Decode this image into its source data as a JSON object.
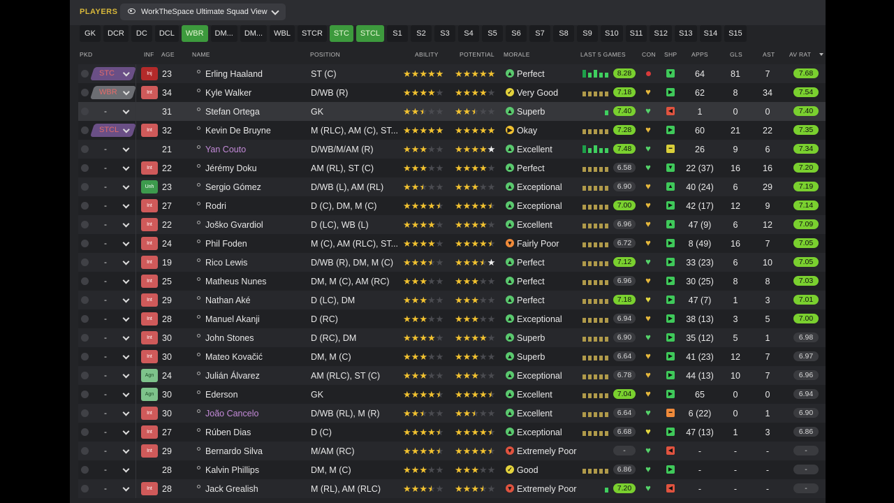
{
  "header": {
    "players_label": "PLAYERS",
    "view_name": "WorkTheSpace Ultimate Squad View"
  },
  "position_filters": [
    {
      "label": "GK",
      "active": false
    },
    {
      "label": "DCR",
      "active": false
    },
    {
      "label": "DC",
      "active": false
    },
    {
      "label": "DCL",
      "active": false
    },
    {
      "label": "WBR",
      "active": true
    },
    {
      "label": "DM...",
      "active": false
    },
    {
      "label": "DM...",
      "active": false
    },
    {
      "label": "WBL",
      "active": false
    },
    {
      "label": "STCR",
      "active": false
    },
    {
      "label": "STC",
      "active": true
    },
    {
      "label": "STCL",
      "active": true
    },
    {
      "label": "S1",
      "active": false
    },
    {
      "label": "S2",
      "active": false
    },
    {
      "label": "S3",
      "active": false
    },
    {
      "label": "S4",
      "active": false
    },
    {
      "label": "S5",
      "active": false
    },
    {
      "label": "S6",
      "active": false
    },
    {
      "label": "S7",
      "active": false
    },
    {
      "label": "S8",
      "active": false
    },
    {
      "label": "S9",
      "active": false
    },
    {
      "label": "S10",
      "active": false
    },
    {
      "label": "S11",
      "active": false
    },
    {
      "label": "S12",
      "active": false
    },
    {
      "label": "S13",
      "active": false
    },
    {
      "label": "S14",
      "active": false
    },
    {
      "label": "S15",
      "active": false
    }
  ],
  "columns": {
    "pkd": "PKD",
    "inf": "INF",
    "age": "AGE",
    "name": "NAME",
    "position": "POSITION",
    "ability": "ABILITY",
    "potential": "POTENTIAL",
    "morale": "MORALE",
    "last5": "LAST 5 GAMES",
    "con": "CON",
    "shp": "SHP",
    "apps": "APPS",
    "gls": "GLS",
    "ast": "AST",
    "avrat": "AV RAT"
  },
  "colors": {
    "accent": "#d8b83a",
    "active_green": "#3d9a3d",
    "rating_green": "#7ad02f",
    "star": "#f2c230"
  },
  "players": [
    {
      "pkd": "STC",
      "inf": "Inj",
      "age": "23",
      "name": "Erling Haaland",
      "purple": false,
      "position": "ST (C)",
      "ability": 5,
      "potential": 5,
      "pot_white": 0,
      "morale": "Perfect",
      "morale_icon": "up-arrow",
      "form": "bars5g",
      "rating": "8.28",
      "rating_green": true,
      "con": "red-dot",
      "shp": "down",
      "apps": "64",
      "gls": "81",
      "ast": "7",
      "avrat": "7.68",
      "avrat_green": true
    },
    {
      "pkd": "WBR",
      "inf": "Int",
      "age": "34",
      "name": "Kyle Walker",
      "purple": false,
      "position": "D/WB (R)",
      "ability": 4,
      "potential": 4,
      "pot_white": 0,
      "morale": "Very Good",
      "morale_icon": "check",
      "form": "bars",
      "rating": "7.18",
      "rating_green": true,
      "con": "heart-gold",
      "shp": "green",
      "apps": "62",
      "gls": "8",
      "ast": "34",
      "avrat": "7.54",
      "avrat_green": true
    },
    {
      "pkd": "-",
      "inf": "",
      "age": "31",
      "name": "Stefan Ortega",
      "purple": false,
      "position": "GK",
      "ability": 2.5,
      "potential": 2.5,
      "pot_white": 0,
      "morale": "Superb",
      "morale_icon": "up-arrow",
      "form": "single",
      "rating": "7.40",
      "rating_green": true,
      "con": "heart-green",
      "shp": "red",
      "apps": "1",
      "gls": "0",
      "ast": "0",
      "avrat": "7.40",
      "avrat_green": true
    },
    {
      "pkd": "STCL",
      "inf": "Int",
      "age": "32",
      "name": "Kevin De Bruyne",
      "purple": false,
      "position": "M (RLC), AM (C), ST...",
      "ability": 5,
      "potential": 5,
      "pot_white": 0,
      "morale": "Okay",
      "morale_icon": "right-arrow",
      "form": "bars",
      "rating": "7.28",
      "rating_green": true,
      "con": "heart-gold",
      "shp": "green",
      "apps": "60",
      "gls": "21",
      "ast": "22",
      "avrat": "7.35",
      "avrat_green": true
    },
    {
      "pkd": "-",
      "inf": "",
      "age": "21",
      "name": "Yan Couto",
      "purple": true,
      "position": "D/WB/M/AM (R)",
      "ability": 3,
      "potential": 4,
      "pot_white": 1,
      "morale": "Excellent",
      "morale_icon": "up-arrow",
      "form": "bars5g",
      "rating": "7.48",
      "rating_green": true,
      "con": "heart-green",
      "shp": "yellow",
      "apps": "26",
      "gls": "9",
      "ast": "6",
      "avrat": "7.34",
      "avrat_green": true
    },
    {
      "pkd": "-",
      "inf": "Int",
      "age": "22",
      "name": "Jérémy Doku",
      "purple": false,
      "position": "AM (RL), ST (C)",
      "ability": 3,
      "potential": 4,
      "pot_white": 0,
      "morale": "Perfect",
      "morale_icon": "up-arrow",
      "form": "bars",
      "rating": "6.58",
      "rating_green": false,
      "con": "heart-green",
      "shp": "down",
      "apps": "22 (37)",
      "gls": "16",
      "ast": "16",
      "avrat": "7.20",
      "avrat_green": true
    },
    {
      "pkd": "-",
      "inf": "Unh",
      "age": "23",
      "name": "Sergio Gómez",
      "purple": false,
      "position": "D/WB (L), AM (RL)",
      "ability": 2.5,
      "potential": 3,
      "pot_white": 0,
      "morale": "Exceptional",
      "morale_icon": "up-arrow",
      "form": "bars",
      "rating": "6.90",
      "rating_green": false,
      "con": "heart-gold",
      "shp": "up",
      "apps": "40 (24)",
      "gls": "6",
      "ast": "29",
      "avrat": "7.19",
      "avrat_green": true
    },
    {
      "pkd": "-",
      "inf": "Int",
      "age": "27",
      "name": "Rodri",
      "purple": false,
      "position": "D (C), DM, M (C)",
      "ability": 4.5,
      "potential": 4.5,
      "pot_white": 0,
      "morale": "Exceptional",
      "morale_icon": "up-arrow",
      "form": "bars",
      "rating": "7.00",
      "rating_green": true,
      "con": "heart-gold",
      "shp": "green",
      "apps": "42 (17)",
      "gls": "12",
      "ast": "9",
      "avrat": "7.14",
      "avrat_green": true
    },
    {
      "pkd": "-",
      "inf": "Int",
      "age": "22",
      "name": "Joško Gvardiol",
      "purple": false,
      "position": "D (LC), WB (L)",
      "ability": 4,
      "potential": 4,
      "pot_white": 0,
      "morale": "Excellent",
      "morale_icon": "up-arrow",
      "form": "bars",
      "rating": "6.96",
      "rating_green": false,
      "con": "heart-gold",
      "shp": "up",
      "apps": "47 (9)",
      "gls": "6",
      "ast": "12",
      "avrat": "7.09",
      "avrat_green": true
    },
    {
      "pkd": "-",
      "inf": "Int",
      "age": "24",
      "name": "Phil Foden",
      "purple": false,
      "position": "M (C), AM (RLC), ST...",
      "ability": 4,
      "potential": 4.5,
      "pot_white": 0,
      "morale": "Fairly Poor",
      "morale_icon": "down-orange",
      "form": "bars",
      "rating": "6.72",
      "rating_green": false,
      "con": "heart-gold",
      "shp": "green",
      "apps": "8 (49)",
      "gls": "16",
      "ast": "7",
      "avrat": "7.05",
      "avrat_green": true
    },
    {
      "pkd": "-",
      "inf": "Int",
      "age": "19",
      "name": "Rico Lewis",
      "purple": false,
      "position": "D/WB (R), DM, M (C)",
      "ability": 3.5,
      "potential": 3.5,
      "pot_white": 1.5,
      "morale": "Perfect",
      "morale_icon": "up-arrow",
      "form": "bars",
      "rating": "7.12",
      "rating_green": true,
      "con": "heart-green",
      "shp": "green",
      "apps": "33 (23)",
      "gls": "6",
      "ast": "10",
      "avrat": "7.05",
      "avrat_green": true
    },
    {
      "pkd": "-",
      "inf": "Int",
      "age": "25",
      "name": "Matheus Nunes",
      "purple": false,
      "position": "DM, M (C), AM (RC)",
      "ability": 3,
      "potential": 3,
      "pot_white": 0,
      "morale": "Perfect",
      "morale_icon": "up-arrow",
      "form": "bars",
      "rating": "6.96",
      "rating_green": false,
      "con": "heart-gold",
      "shp": "green",
      "apps": "30 (25)",
      "gls": "8",
      "ast": "8",
      "avrat": "7.03",
      "avrat_green": true
    },
    {
      "pkd": "-",
      "inf": "Int",
      "age": "29",
      "name": "Nathan Aké",
      "purple": false,
      "position": "D (LC), DM",
      "ability": 3,
      "potential": 3,
      "pot_white": 0,
      "morale": "Perfect",
      "morale_icon": "up-arrow",
      "form": "bars",
      "rating": "7.18",
      "rating_green": true,
      "con": "heart-yellow",
      "shp": "green",
      "apps": "47 (7)",
      "gls": "1",
      "ast": "3",
      "avrat": "7.01",
      "avrat_green": true
    },
    {
      "pkd": "-",
      "inf": "Int",
      "age": "28",
      "name": "Manuel Akanji",
      "purple": false,
      "position": "D (RC)",
      "ability": 3,
      "potential": 3,
      "pot_white": 0,
      "morale": "Exceptional",
      "morale_icon": "up-arrow",
      "form": "bars",
      "rating": "6.94",
      "rating_green": false,
      "con": "heart-gold",
      "shp": "green",
      "apps": "38 (13)",
      "gls": "3",
      "ast": "5",
      "avrat": "7.00",
      "avrat_green": true
    },
    {
      "pkd": "-",
      "inf": "Int",
      "age": "30",
      "name": "John Stones",
      "purple": false,
      "position": "D (RC), DM",
      "ability": 4,
      "potential": 4,
      "pot_white": 0,
      "morale": "Superb",
      "morale_icon": "up-arrow",
      "form": "bars",
      "rating": "6.90",
      "rating_green": false,
      "con": "heart-green",
      "shp": "green",
      "apps": "35 (12)",
      "gls": "5",
      "ast": "1",
      "avrat": "6.98",
      "avrat_green": false
    },
    {
      "pkd": "-",
      "inf": "Int",
      "age": "30",
      "name": "Mateo Kovačić",
      "purple": false,
      "position": "DM, M (C)",
      "ability": 3,
      "potential": 3,
      "pot_white": 0,
      "morale": "Superb",
      "morale_icon": "up-arrow",
      "form": "bars",
      "rating": "6.64",
      "rating_green": false,
      "con": "heart-gold",
      "shp": "green",
      "apps": "41 (23)",
      "gls": "12",
      "ast": "7",
      "avrat": "6.97",
      "avrat_green": false
    },
    {
      "pkd": "-",
      "inf": "Agn",
      "age": "24",
      "name": "Julián Álvarez",
      "purple": false,
      "position": "AM (RLC), ST (C)",
      "ability": 3,
      "potential": 3,
      "pot_white": 0,
      "morale": "Exceptional",
      "morale_icon": "up-arrow",
      "form": "bars",
      "rating": "6.78",
      "rating_green": false,
      "con": "heart-gold",
      "shp": "green",
      "apps": "44 (13)",
      "gls": "10",
      "ast": "7",
      "avrat": "6.96",
      "avrat_green": false
    },
    {
      "pkd": "-",
      "inf": "Agn",
      "age": "30",
      "name": "Ederson",
      "purple": false,
      "position": "GK",
      "ability": 4.5,
      "potential": 4.5,
      "pot_white": 0,
      "morale": "Excellent",
      "morale_icon": "up-arrow",
      "form": "bars",
      "rating": "7.04",
      "rating_green": true,
      "con": "heart-gold",
      "shp": "green",
      "apps": "65",
      "gls": "0",
      "ast": "0",
      "avrat": "6.94",
      "avrat_green": false
    },
    {
      "pkd": "-",
      "inf": "Int",
      "age": "30",
      "name": "João Cancelo",
      "purple": true,
      "position": "D/WB (RL), M (R)",
      "ability": 2.5,
      "potential": 2.5,
      "pot_white": 0,
      "morale": "Excellent",
      "morale_icon": "up-arrow",
      "form": "bars",
      "rating": "6.64",
      "rating_green": false,
      "con": "heart-green",
      "shp": "orange",
      "apps": "6 (22)",
      "gls": "0",
      "ast": "1",
      "avrat": "6.90",
      "avrat_green": false
    },
    {
      "pkd": "-",
      "inf": "Int",
      "age": "27",
      "name": "Rúben Dias",
      "purple": false,
      "position": "D (C)",
      "ability": 4.5,
      "potential": 4.5,
      "pot_white": 0,
      "morale": "Exceptional",
      "morale_icon": "up-arrow",
      "form": "bars",
      "rating": "6.68",
      "rating_green": false,
      "con": "heart-yellow",
      "shp": "green",
      "apps": "47 (13)",
      "gls": "1",
      "ast": "3",
      "avrat": "6.86",
      "avrat_green": false
    },
    {
      "pkd": "-",
      "inf": "Int",
      "age": "29",
      "name": "Bernardo Silva",
      "purple": false,
      "position": "M/AM (RC)",
      "ability": 4.5,
      "potential": 4.5,
      "pot_white": 0,
      "morale": "Extremely Poor",
      "morale_icon": "down-red",
      "form": "none",
      "rating": "-",
      "rating_green": false,
      "con": "heart-green",
      "shp": "red",
      "apps": "-",
      "gls": "-",
      "ast": "-",
      "avrat": "-",
      "avrat_green": false
    },
    {
      "pkd": "-",
      "inf": "",
      "age": "28",
      "name": "Kalvin Phillips",
      "purple": false,
      "position": "DM, M (C)",
      "ability": 3,
      "potential": 3,
      "pot_white": 0,
      "morale": "Good",
      "morale_icon": "check",
      "form": "bars",
      "rating": "6.86",
      "rating_green": false,
      "con": "heart-green",
      "shp": "green",
      "apps": "-",
      "gls": "-",
      "ast": "-",
      "avrat": "-",
      "avrat_green": false
    },
    {
      "pkd": "-",
      "inf": "Int",
      "age": "28",
      "name": "Jack Grealish",
      "purple": false,
      "position": "M (RL), AM (RLC)",
      "ability": 3.5,
      "potential": 3.5,
      "pot_white": 0,
      "morale": "Extremely Poor",
      "morale_icon": "down-red",
      "form": "single",
      "rating": "7.20",
      "rating_green": true,
      "con": "heart-green",
      "shp": "red",
      "apps": "-",
      "gls": "-",
      "ast": "-",
      "avrat": "-",
      "avrat_green": false
    }
  ]
}
